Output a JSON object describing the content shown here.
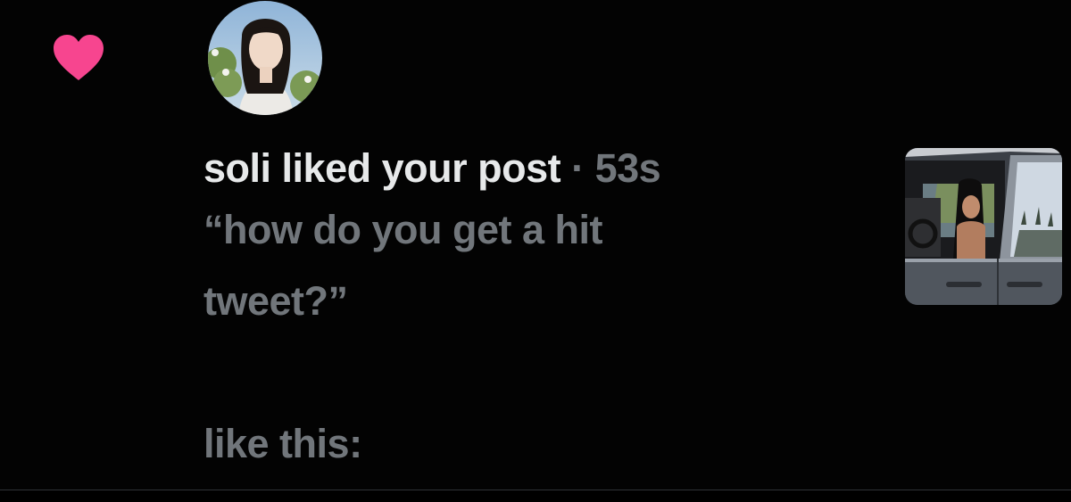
{
  "notification": {
    "type_icon": "heart-icon",
    "icon_color": "#f91880",
    "avatar": "user-avatar-photo",
    "actor_name": "soli",
    "action": " liked your post",
    "separator": " · ",
    "timestamp": "53s",
    "post_text": "“how do you get a hit\ntweet?”\n\nlike this:",
    "thumbnail": "post-media-thumbnail"
  },
  "colors": {
    "background": "#000000",
    "primary_text": "#e7e9ea",
    "secondary_text": "#71767b",
    "like_pink": "#f91880"
  }
}
